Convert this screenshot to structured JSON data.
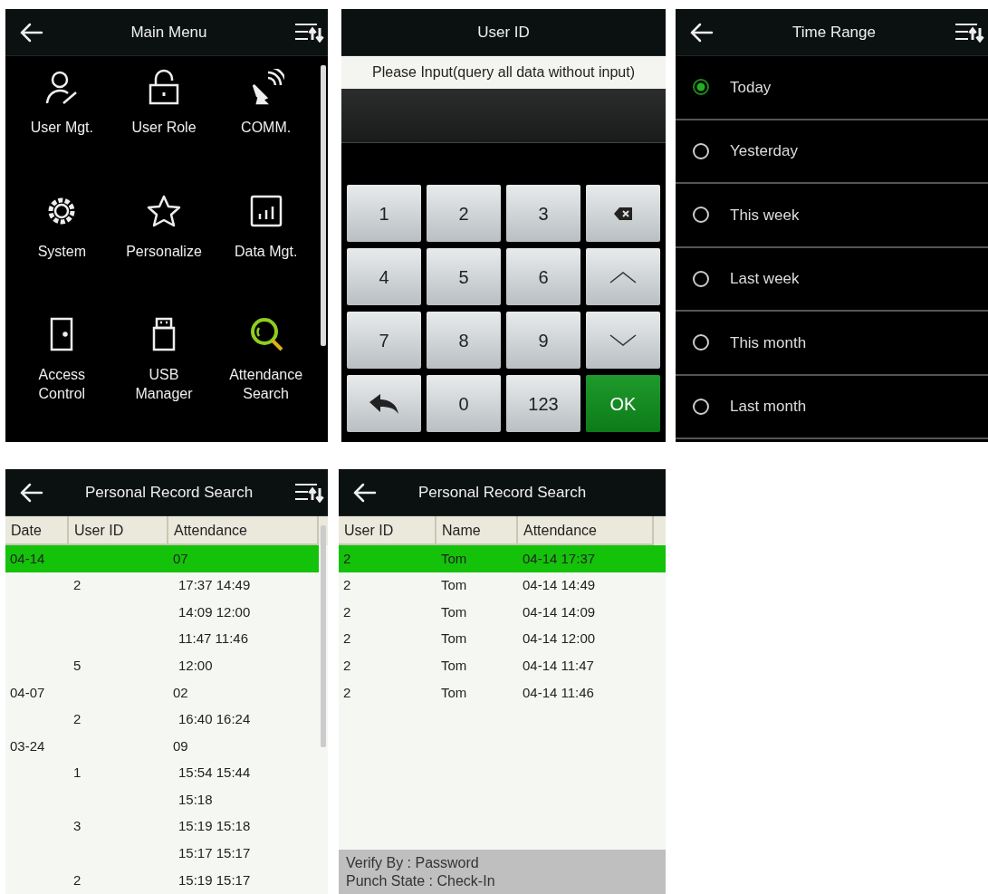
{
  "screens": [
    {
      "kind": "main_menu",
      "title": "Main Menu",
      "back": true,
      "sort": true,
      "items": [
        {
          "label": "User Mgt.",
          "selected": false
        },
        {
          "label": "User Role",
          "selected": false
        },
        {
          "label": "COMM.",
          "selected": false
        },
        {
          "label": "System",
          "selected": false
        },
        {
          "label": "Personalize",
          "selected": false
        },
        {
          "label": "Data Mgt.",
          "selected": false
        },
        {
          "label": "Access Control",
          "selected": false
        },
        {
          "label": "USB Manager",
          "selected": false
        },
        {
          "label": "Attendance Search",
          "selected": true
        }
      ]
    },
    {
      "kind": "keypad",
      "title": "User ID",
      "back": false,
      "sort": false,
      "prompt": "Please Input(query all data without input)",
      "keys": [
        {
          "kind": "digit",
          "label": "1"
        },
        {
          "kind": "digit",
          "label": "2"
        },
        {
          "kind": "digit",
          "label": "3"
        },
        {
          "kind": "backspace"
        },
        {
          "kind": "digit",
          "label": "4"
        },
        {
          "kind": "digit",
          "label": "5"
        },
        {
          "kind": "digit",
          "label": "6"
        },
        {
          "kind": "up"
        },
        {
          "kind": "digit",
          "label": "7"
        },
        {
          "kind": "digit",
          "label": "8"
        },
        {
          "kind": "digit",
          "label": "9"
        },
        {
          "kind": "down"
        },
        {
          "kind": "return"
        },
        {
          "kind": "digit",
          "label": "0"
        },
        {
          "kind": "digit",
          "label": "123"
        },
        {
          "kind": "confirm",
          "label": "OK"
        }
      ]
    },
    {
      "kind": "radio_list",
      "title": "Time Range",
      "back": true,
      "sort": true,
      "options": [
        {
          "label": "Today",
          "selected": true
        },
        {
          "label": "Yesterday",
          "selected": false
        },
        {
          "label": "This week",
          "selected": false
        },
        {
          "label": "Last week",
          "selected": false
        },
        {
          "label": "This month",
          "selected": false
        },
        {
          "label": "Last month",
          "selected": false
        }
      ]
    },
    {
      "kind": "table",
      "title": "Personal Record Search",
      "back": true,
      "sort": true,
      "columns": [
        "Date",
        "User ID",
        "Attendance"
      ],
      "rows": [
        {
          "cells": [
            "04-14",
            "",
            "07"
          ],
          "selected": true
        },
        {
          "cells": [
            "",
            "2",
            "17:37 14:49"
          ],
          "selected": false
        },
        {
          "cells": [
            "",
            "",
            "14:09 12:00"
          ],
          "selected": false
        },
        {
          "cells": [
            "",
            "",
            "11:47 11:46"
          ],
          "selected": false
        },
        {
          "cells": [
            "",
            "5",
            "12:00"
          ],
          "selected": false
        },
        {
          "cells": [
            "04-07",
            "",
            "02"
          ],
          "selected": false
        },
        {
          "cells": [
            "",
            "2",
            "16:40 16:24"
          ],
          "selected": false
        },
        {
          "cells": [
            "03-24",
            "",
            "09"
          ],
          "selected": false
        },
        {
          "cells": [
            "",
            "1",
            "15:54 15:44"
          ],
          "selected": false
        },
        {
          "cells": [
            "",
            "",
            "15:18"
          ],
          "selected": false
        },
        {
          "cells": [
            "",
            "3",
            "15:19 15:18"
          ],
          "selected": false
        },
        {
          "cells": [
            "",
            "",
            "15:17 15:17"
          ],
          "selected": false
        },
        {
          "cells": [
            "",
            "2",
            "15:19 15:17"
          ],
          "selected": false
        }
      ]
    },
    {
      "kind": "table",
      "title": "Personal Record Search",
      "back": true,
      "sort": false,
      "columns": [
        "User ID",
        "Name",
        "Attendance"
      ],
      "rows": [
        {
          "cells": [
            "2",
            "Tom",
            "04-14 17:37"
          ],
          "selected": true
        },
        {
          "cells": [
            "2",
            "Tom",
            "04-14 14:49"
          ],
          "selected": false
        },
        {
          "cells": [
            "2",
            "Tom",
            "04-14 14:09"
          ],
          "selected": false
        },
        {
          "cells": [
            "2",
            "Tom",
            "04-14 12:00"
          ],
          "selected": false
        },
        {
          "cells": [
            "2",
            "Tom",
            "04-14 11:47"
          ],
          "selected": false
        },
        {
          "cells": [
            "2",
            "Tom",
            "04-14 11:46"
          ],
          "selected": false
        }
      ],
      "footer": [
        "Verify By : Password",
        "Punch State : Check-In"
      ]
    }
  ]
}
